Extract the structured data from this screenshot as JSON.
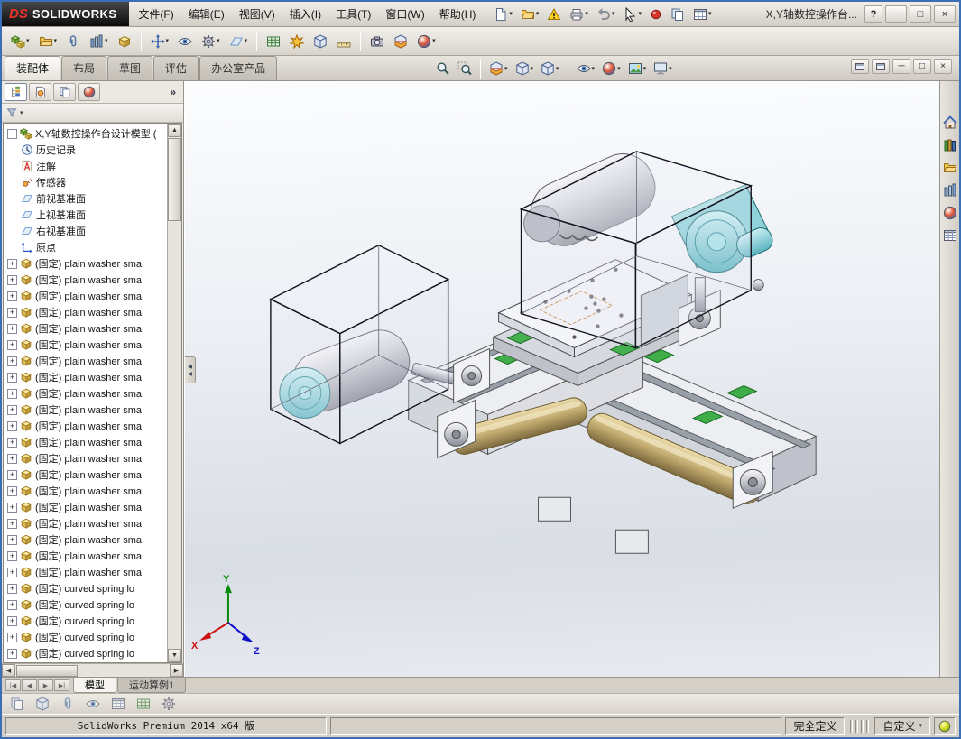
{
  "icons": {
    "dropdown": "▾",
    "overflow": "»",
    "plus": "+",
    "minus": "-",
    "minimize": "─",
    "maximize": "□",
    "close": "×",
    "help": "?",
    "up": "▲",
    "down": "▼",
    "left": "◀",
    "right": "▶",
    "vcr_start": "|◀",
    "vcr_prev": "◀",
    "vcr_next": "▶",
    "vcr_end": "▶|"
  },
  "titlebar": {
    "logo_ds": "DS",
    "logo_text": "SOLIDWORKS",
    "menus": [
      "文件(F)",
      "编辑(E)",
      "视图(V)",
      "插入(I)",
      "工具(T)",
      "窗口(W)",
      "帮助(H)"
    ],
    "title": "X,Y轴数控操作台..."
  },
  "command_bar": {
    "tabs": [
      "装配体",
      "布局",
      "草图",
      "评估",
      "办公室产品"
    ],
    "active_tab": "装配体"
  },
  "feature_tree": {
    "root": "X,Y轴数控操作台设计模型 (",
    "folders": [
      "历史记录",
      "注解",
      "传感器",
      "前视基准面",
      "上视基准面",
      "右视基准面",
      "原点"
    ],
    "parts": [
      "(固定) plain washer sma",
      "(固定) plain washer sma",
      "(固定) plain washer sma",
      "(固定) plain washer sma",
      "(固定) plain washer sma",
      "(固定) plain washer sma",
      "(固定) plain washer sma",
      "(固定) plain washer sma",
      "(固定) plain washer sma",
      "(固定) plain washer sma",
      "(固定) plain washer sma",
      "(固定) plain washer sma",
      "(固定) plain washer sma",
      "(固定) plain washer sma",
      "(固定) plain washer sma",
      "(固定) plain washer sma",
      "(固定) plain washer sma",
      "(固定) plain washer sma",
      "(固定) plain washer sma",
      "(固定) plain washer sma",
      "(固定) curved spring lo",
      "(固定) curved spring lo",
      "(固定) curved spring lo",
      "(固定) curved spring lo",
      "(固定) curved spring lo"
    ]
  },
  "viewport": {
    "triad": {
      "x": "X",
      "y": "Y",
      "z": "Z"
    }
  },
  "motion_bar": {
    "tabs": [
      "模型",
      "运动算例1"
    ],
    "active_tab": "模型"
  },
  "statusbar": {
    "app_version": "SolidWorks Premium 2014 x64 版",
    "define_status": "完全定义",
    "unit_system": "自定义"
  }
}
